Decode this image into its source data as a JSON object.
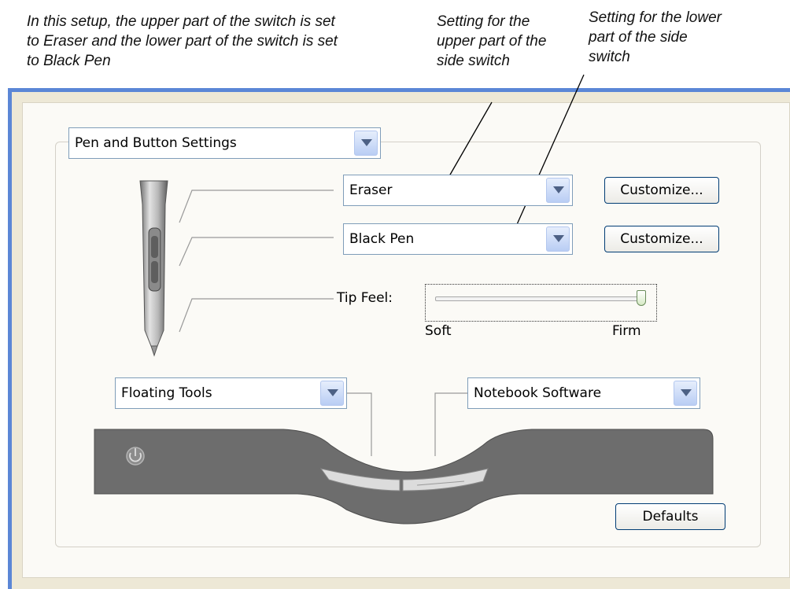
{
  "callouts": {
    "setup_note": "In this setup, the upper part of the switch is set to Eraser and the lower part of the switch is set to Black Pen",
    "upper_note": "Setting for the upper part of the side switch",
    "lower_note": "Setting for the lower part of the side switch"
  },
  "panel": {
    "mode_select": "Pen and Button Settings",
    "upper_switch": {
      "value": "Eraser",
      "customize_label": "Customize..."
    },
    "lower_switch": {
      "value": "Black Pen",
      "customize_label": "Customize..."
    },
    "tip_feel": {
      "label": "Tip Feel:",
      "min_label": "Soft",
      "max_label": "Firm",
      "level": 1.0
    },
    "left_button_select": "Floating Tools",
    "right_button_select": "Notebook Software",
    "defaults_label": "Defaults"
  },
  "colors": {
    "frame_blue": "#5b86d6",
    "panel_beige": "#ede8d6",
    "select_border": "#7f9db9"
  }
}
